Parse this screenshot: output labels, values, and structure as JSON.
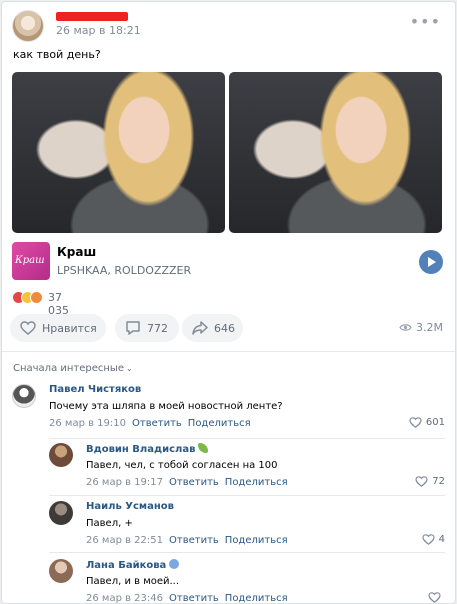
{
  "post": {
    "date": "26 мар в 18:21",
    "text": "как твой день?",
    "more_icon": "more-horizontal-icon"
  },
  "audio": {
    "cover_text": "Краш",
    "title": "Краш",
    "artist": "LPSHKAA, ROLDOZZZER"
  },
  "reactions": {
    "count": "37 035"
  },
  "actions": {
    "like_label": "Нравится",
    "comments_count": "772",
    "shares_count": "646",
    "views": "3.2M"
  },
  "comments_sort": "Сначала интересные",
  "comments": [
    {
      "name": "Павел Чистяков",
      "text": "Почему эта шляпа в моей новостной ленте?",
      "date": "26 мар в 19:10",
      "reply": "Ответить",
      "share": "Поделиться",
      "likes": "601"
    },
    {
      "name": "Вдовин Владислав",
      "text": "Павел, чел, с тобой согласен на 100",
      "date": "26 мар в 19:17",
      "reply": "Ответить",
      "share": "Поделиться",
      "likes": "72"
    },
    {
      "name": "Наиль Усманов",
      "text": "Павел, +",
      "date": "26 мар в 22:51",
      "reply": "Ответить",
      "share": "Поделиться",
      "likes": "4"
    },
    {
      "name": "Лана Байкова",
      "text": "Павел, и в моей...",
      "date": "26 мар в 23:46",
      "reply": "Ответить",
      "share": "Поделиться",
      "likes": ""
    }
  ]
}
